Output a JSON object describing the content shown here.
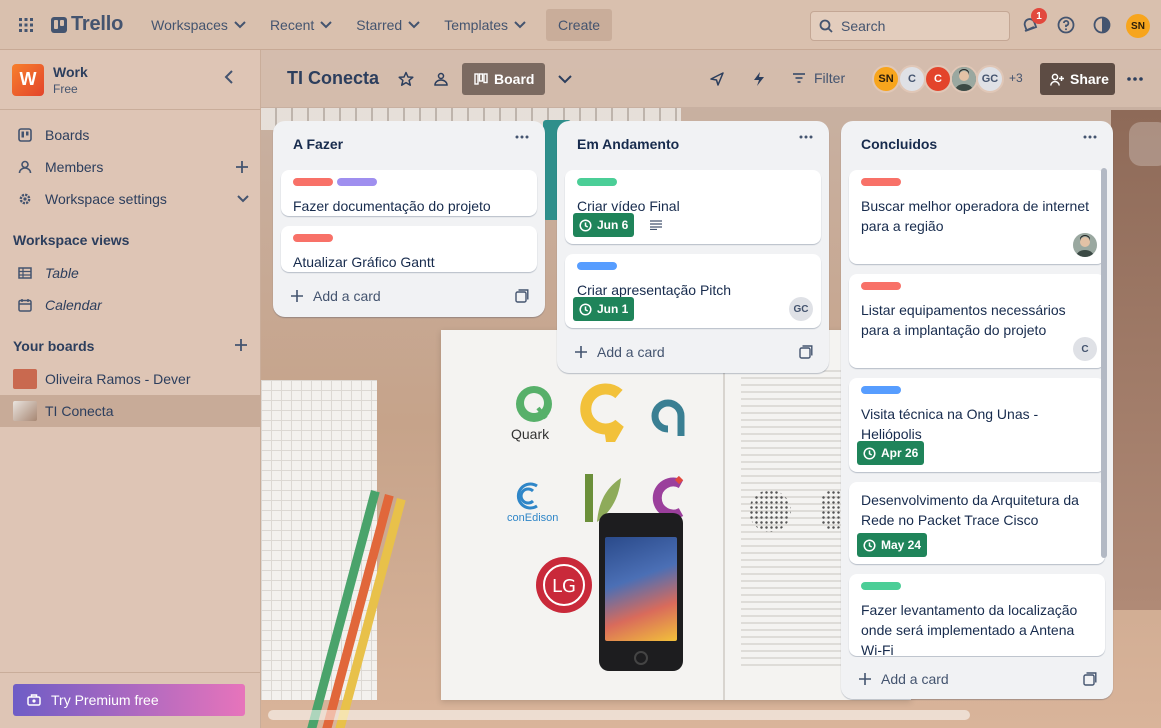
{
  "topbar": {
    "app_name": "Trello",
    "nav": [
      "Workspaces",
      "Recent",
      "Starred",
      "Templates"
    ],
    "create_label": "Create",
    "search_placeholder": "Search",
    "notification_count": "1",
    "user_initials": "SN"
  },
  "sidebar": {
    "workspace_initial": "W",
    "workspace_name": "Work",
    "workspace_plan": "Free",
    "items": [
      {
        "label": "Boards",
        "icon": "trello-board-icon"
      },
      {
        "label": "Members",
        "icon": "person-icon"
      },
      {
        "label": "Workspace settings",
        "icon": "gear-icon"
      }
    ],
    "views_title": "Workspace views",
    "views": [
      {
        "label": "Table",
        "icon": "table-icon"
      },
      {
        "label": "Calendar",
        "icon": "calendar-icon"
      }
    ],
    "boards_title": "Your boards",
    "boards": [
      {
        "label": "Oliveira Ramos - Dever",
        "color": "#c9694f"
      },
      {
        "label": "TI Conecta",
        "color": "#b99683"
      }
    ],
    "premium_label": "Try Premium free"
  },
  "board": {
    "title": "TI Conecta",
    "view_label": "Board",
    "filter_label": "Filter",
    "members": [
      {
        "initials": "SN",
        "bg": "#f7a51d",
        "fg": "#2b1e0b"
      },
      {
        "initials": "C",
        "bg": "#dfe1e6",
        "fg": "#44546f"
      },
      {
        "initials": "C",
        "bg": "#e3442b",
        "fg": "#ffffff"
      },
      {
        "initials": "",
        "bg": "#6b7a6e",
        "fg": "#ffffff"
      },
      {
        "initials": "GC",
        "bg": "#dfe1e6",
        "fg": "#44546f"
      }
    ],
    "members_more": "+3",
    "share_label": "Share"
  },
  "colors": {
    "label_red": "#f87168",
    "label_purple": "#9f8fef",
    "label_green": "#4bce97",
    "label_blue": "#579dff",
    "due_green": "#1f845a"
  },
  "lists": [
    {
      "title": "A Fazer",
      "cards": [
        {
          "labels": [
            "#f87168",
            "#9f8fef"
          ],
          "title": "Fazer documentação do projeto"
        },
        {
          "labels": [
            "#f87168"
          ],
          "title": "Atualizar Gráfico Gantt"
        }
      ],
      "add_label": "Add a card"
    },
    {
      "title": "Em Andamento",
      "cards": [
        {
          "labels": [
            "#4bce97"
          ],
          "title": "Criar vídeo Final",
          "due": "Jun 6"
        },
        {
          "labels": [
            "#579dff"
          ],
          "title": "Criar apresentação Pitch",
          "due": "Jun 1",
          "member": "GC"
        }
      ],
      "add_label": "Add a card"
    },
    {
      "title": "Concluidos",
      "cards": [
        {
          "labels": [
            "#f87168"
          ],
          "title": "Buscar melhor operadora de internet para a região"
        },
        {
          "labels": [
            "#f87168"
          ],
          "title": "Listar equipamentos necessários para a implantação do projeto",
          "member": "C"
        },
        {
          "labels": [
            "#579dff"
          ],
          "title": "Visita técnica na Ong Unas - Heliópolis",
          "due": "Apr 26"
        },
        {
          "labels": [],
          "title": "Desenvolvimento da Arquitetura da Rede no Packet Trace Cisco",
          "due": "May 24"
        },
        {
          "labels": [
            "#4bce97"
          ],
          "title": "Fazer levantamento da localização onde será implementado a Antena Wi-Fi"
        }
      ],
      "add_label": "Add a card"
    }
  ],
  "background_logos": [
    "Quark",
    "conEdison"
  ]
}
